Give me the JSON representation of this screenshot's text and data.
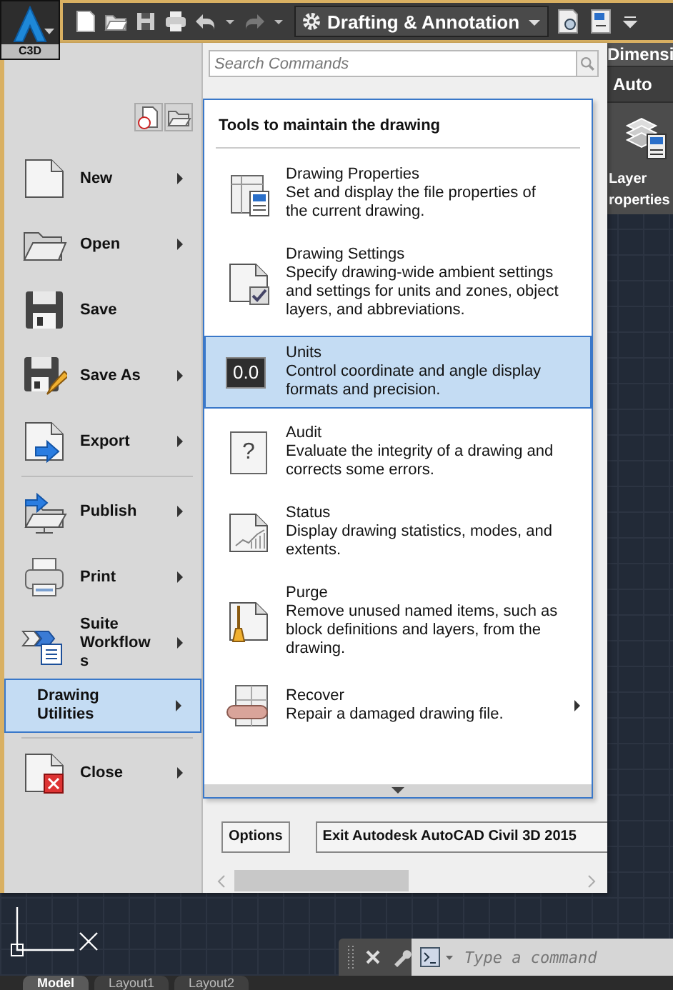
{
  "app_button": {
    "label": "C3D"
  },
  "quick_access": {
    "workspace": "Drafting & Annotation"
  },
  "ribbon": {
    "tab": "Dimensi",
    "panel": "Auto",
    "tool": {
      "line_1": "Layer",
      "line_2": "roperties"
    }
  },
  "menu": {
    "search": {
      "placeholder": "Search Commands"
    },
    "groups": [
      [
        {
          "label": "New",
          "kind": "new",
          "submenu": true,
          "selected": false
        },
        {
          "label": "Open",
          "kind": "open",
          "submenu": true,
          "selected": false
        },
        {
          "label": "Save",
          "kind": "save",
          "submenu": false,
          "selected": false
        },
        {
          "label": "Save As",
          "kind": "saveas",
          "submenu": true,
          "selected": false
        },
        {
          "label": "Export",
          "kind": "export",
          "submenu": true,
          "selected": false
        }
      ],
      [
        {
          "label": "Publish",
          "kind": "publish",
          "submenu": true,
          "selected": false
        },
        {
          "label": "Print",
          "kind": "print",
          "submenu": true,
          "selected": false
        },
        {
          "label": "Suite Workflows",
          "kind": "workflow",
          "submenu": true,
          "selected": false
        },
        {
          "label": "Drawing Utilities",
          "kind": "plain",
          "submenu": true,
          "selected": true
        }
      ],
      [
        {
          "label": "Close",
          "kind": "close",
          "submenu": true,
          "selected": false
        }
      ]
    ],
    "panel": {
      "title": "Tools to maintain the drawing",
      "items": [
        {
          "kind": "properties",
          "title": "Drawing Properties",
          "description": "Set and display the file properties of the current drawing.",
          "submenu": false,
          "selected": false
        },
        {
          "kind": "settings",
          "title": "Drawing Settings",
          "description": "Specify drawing-wide ambient settings and settings for units and zones, object layers, and abbreviations.",
          "submenu": false,
          "selected": false
        },
        {
          "kind": "units",
          "sample": "0.0",
          "title": "Units",
          "description": "Control coordinate and angle display formats and precision.",
          "submenu": false,
          "selected": true
        },
        {
          "kind": "audit",
          "sample": "?",
          "title": "Audit",
          "description": "Evaluate the integrity of a drawing and corrects some errors.",
          "submenu": false,
          "selected": false
        },
        {
          "kind": "status",
          "title": "Status",
          "description": "Display drawing statistics, modes, and extents.",
          "submenu": false,
          "selected": false
        },
        {
          "kind": "purge",
          "title": "Purge",
          "description": "Remove unused named items, such as block definitions and layers, from the drawing.",
          "submenu": false,
          "selected": false
        },
        {
          "kind": "recover",
          "title": "Recover",
          "description": "Repair a damaged drawing file.",
          "submenu": true,
          "selected": false
        }
      ]
    },
    "buttons": [
      "Options",
      "Exit Autodesk AutoCAD Civil 3D 2015"
    ]
  },
  "command_line": {
    "placeholder": "Type a command"
  },
  "layout_tabs": [
    {
      "label": "Model",
      "selected": true
    },
    {
      "label": "Layout1",
      "selected": false
    },
    {
      "label": "Layout2",
      "selected": false
    }
  ]
}
